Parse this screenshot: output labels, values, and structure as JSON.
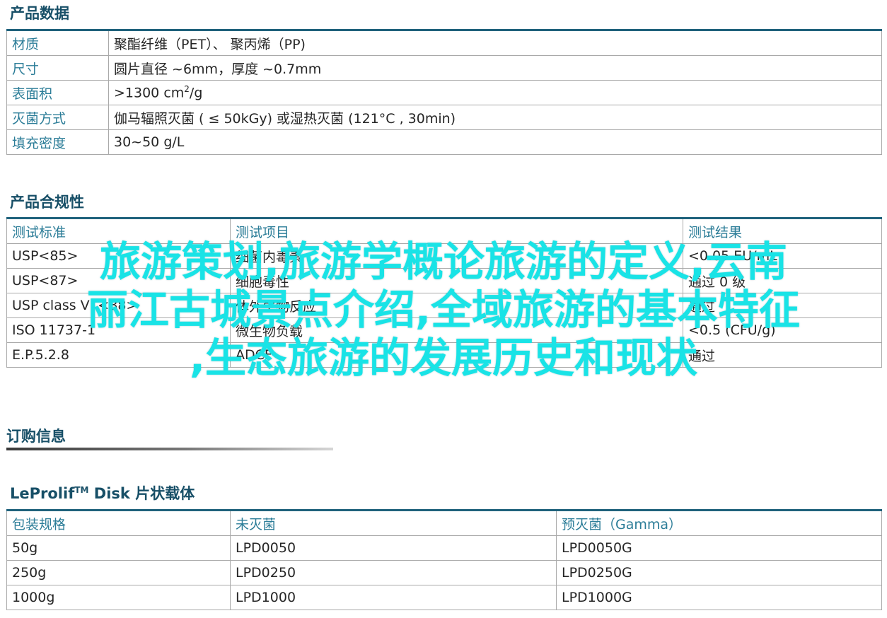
{
  "product_data": {
    "title": "产品数据",
    "rows": [
      {
        "label": "材质",
        "value": "聚酯纤维（PET）、 聚丙烯（PP)"
      },
      {
        "label": "尺寸",
        "value": "圆片直径 ~6mm，厚度 ~0.7mm"
      },
      {
        "label": "表面积",
        "value_prefix": ">1300 cm",
        "value_sup": "2",
        "value_suffix": "/g"
      },
      {
        "label": "灭菌方式",
        "value": "伽马辐照灭菌 ( ≤ 50kGy) 或湿热灭菌 (121°C , 30min)"
      },
      {
        "label": "填充密度",
        "value": "30~50 g/L"
      }
    ]
  },
  "compliance": {
    "title": "产品合规性",
    "headers": [
      "测试标准",
      "测试项目",
      "测试结果"
    ],
    "rows": [
      [
        "USP<85>",
        "细菌内毒素",
        "<0.05 EU/mL"
      ],
      [
        "USP<87>",
        "细胞毒性",
        "通过 0 级"
      ],
      [
        "USP class VI <88>",
        "体外生物反应",
        "通过"
      ],
      [
        "ISO 11737-1",
        "微生物负载",
        "<0.5 (CFU/g)"
      ],
      [
        "E.P.5.2.8",
        "ADCF",
        "通过"
      ]
    ]
  },
  "ordering": {
    "title": "订购信息"
  },
  "disk": {
    "title_prefix": "LeProlif",
    "title_tm": "TM",
    "title_suffix": " Disk 片状载体",
    "headers": [
      "包装规格",
      "未灭菌",
      "预灭菌（Gamma）"
    ],
    "rows": [
      [
        "50g",
        "LPD0050",
        "LPD0050G"
      ],
      [
        "250g",
        "LPD0250",
        "LPD0250G"
      ],
      [
        "1000g",
        "LPD1000",
        "LPD1000G"
      ]
    ]
  },
  "overlay_text": {
    "line1": "旅游策划,旅游学概论旅游的定义,云南",
    "line2": "丽江古城景点介绍,全域旅游的基本特征",
    "line3": ",生态旅游的发展历史和现状"
  }
}
